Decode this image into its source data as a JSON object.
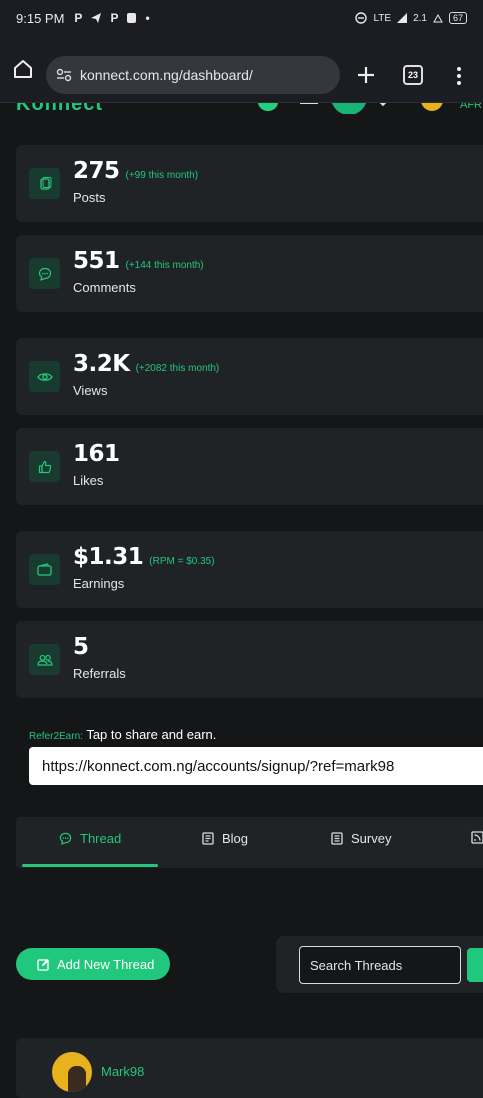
{
  "status_bar": {
    "time": "9:15 PM",
    "notif_icons": [
      "P",
      "telegram-icon",
      "P",
      "app-icon",
      "•"
    ],
    "network": "LTE",
    "speed": "2.1",
    "battery": "67"
  },
  "browser": {
    "url": "konnect.com.ng/dashboard/",
    "tab_count": "23"
  },
  "stats": [
    {
      "icon": "posts-icon",
      "value": "275",
      "extra": "(+99 this month)",
      "label": "Posts"
    },
    {
      "icon": "comments-icon",
      "value": "551",
      "extra": "(+144 this month)",
      "label": "Comments"
    },
    {
      "icon": "views-icon",
      "value": "3.2K",
      "extra": "(+2082 this month)",
      "label": "Views"
    },
    {
      "icon": "likes-icon",
      "value": "161",
      "extra": "",
      "label": "Likes"
    },
    {
      "icon": "wallet-icon",
      "value": "$1.31",
      "extra": "(RPM = $0.35)",
      "label": "Earnings"
    },
    {
      "icon": "referrals-icon",
      "value": "5",
      "extra": "",
      "label": "Referrals"
    }
  ],
  "refer": {
    "tag": "Refer2Earn:",
    "text": "Tap to share and earn.",
    "link": "https://konnect.com.ng/accounts/signup/?ref=mark98"
  },
  "tabs": [
    {
      "label": "Thread",
      "icon": "chat-icon",
      "active": true
    },
    {
      "label": "Blog",
      "icon": "blog-icon",
      "active": false
    },
    {
      "label": "Survey",
      "icon": "survey-icon",
      "active": false
    }
  ],
  "actions": {
    "add_thread": "Add New Thread",
    "search_placeholder": "Search Threads"
  },
  "post": {
    "author": "Mark98"
  },
  "colors": {
    "accent": "#25c57c",
    "card_bg": "#202326",
    "page_bg": "#141618"
  }
}
